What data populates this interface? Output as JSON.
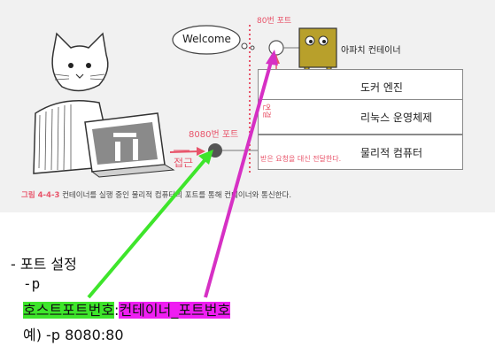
{
  "figure": {
    "welcome_bubble": "Welcome",
    "container_port_label": "80번 포트",
    "container_label": "아파치 컨테이너",
    "layers": [
      "도커 엔진",
      "리눅스 운영체제",
      "물리적 컴퓨터"
    ],
    "host_port_label": "8080번 포트",
    "access_label": "접근",
    "connect_label": "연결",
    "forward_label": "받은 요청을 대신 전달한다.",
    "caption_number": "그림 4-4-3",
    "caption_text": "컨테이너를 실행 중인 물리적 컴퓨터의 포트를 통해 컨테이너와 통신한다."
  },
  "notes": {
    "heading": "- 포트 설정",
    "flag": "-p",
    "host_port_term": "호스트포트번호",
    "separator": ":",
    "container_port_term": "컨테이너_포트번호",
    "example": "예) -p 8080:80"
  },
  "colors": {
    "accent_red": "#e8546a",
    "highlight_green": "#3ee52b",
    "highlight_pink": "#ef1ef2",
    "container_olive": "#b8a02b"
  }
}
